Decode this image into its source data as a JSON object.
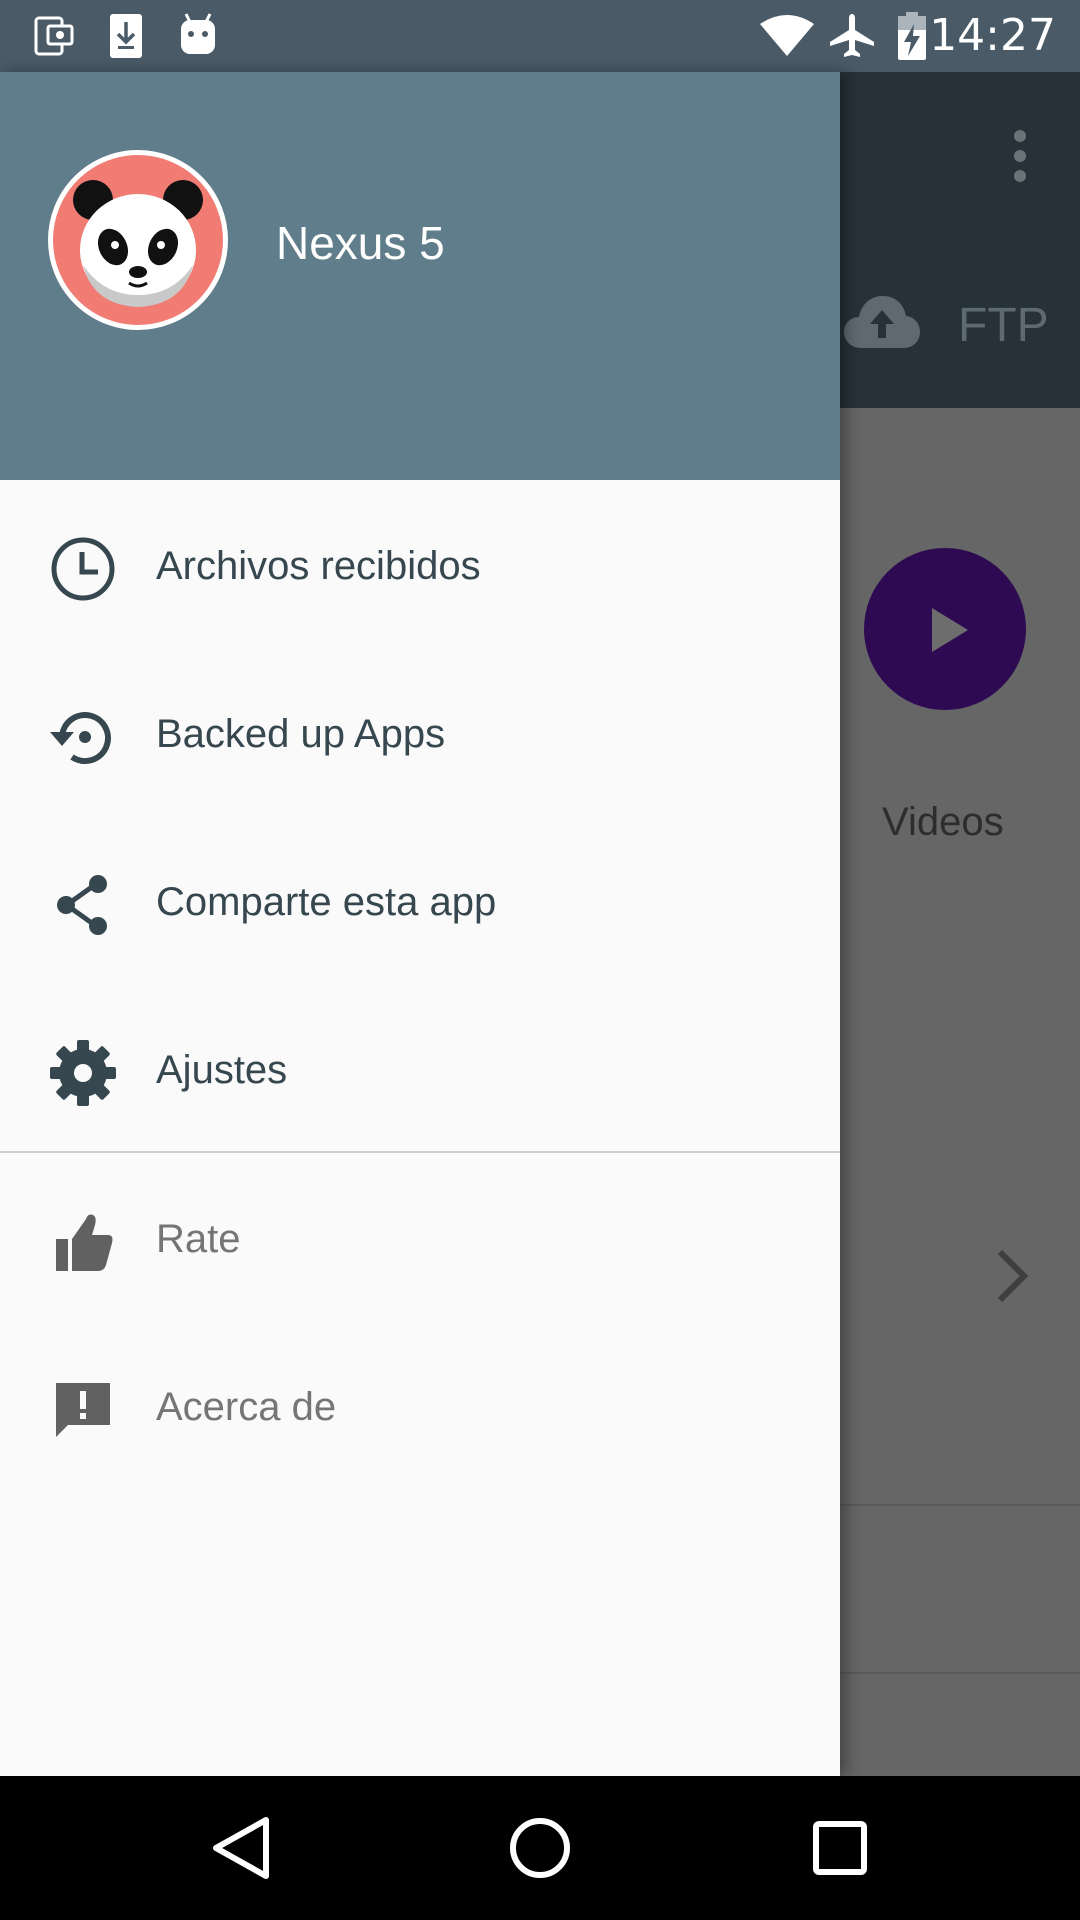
{
  "status_bar": {
    "time": "14:27",
    "left_icons": [
      "screenshot-icon",
      "download-icon",
      "android-icon"
    ],
    "right_icons": [
      "wifi-icon",
      "airplane-mode-icon",
      "battery-charging-icon"
    ]
  },
  "background": {
    "ftp_label": "FTP",
    "videos_label": "Videos"
  },
  "drawer": {
    "device_name": "Nexus 5",
    "items": [
      {
        "label": "Archivos recibidos",
        "icon": "clock-icon"
      },
      {
        "label": "Backed up Apps",
        "icon": "restore-icon"
      },
      {
        "label": "Comparte esta app",
        "icon": "share-icon"
      },
      {
        "label": "Ajustes",
        "icon": "gear-icon"
      }
    ],
    "secondary_items": [
      {
        "label": "Rate",
        "icon": "thumb-up-icon"
      },
      {
        "label": "Acerca de",
        "icon": "feedback-icon"
      }
    ]
  },
  "colors": {
    "header": "#607d8b",
    "status_bar": "#4a5b67",
    "drawer_bg": "#fafafa",
    "text_primary": "#37474f",
    "text_secondary": "#757575",
    "avatar_bg": "#f07c74",
    "video_accent": "#2e0a52"
  }
}
